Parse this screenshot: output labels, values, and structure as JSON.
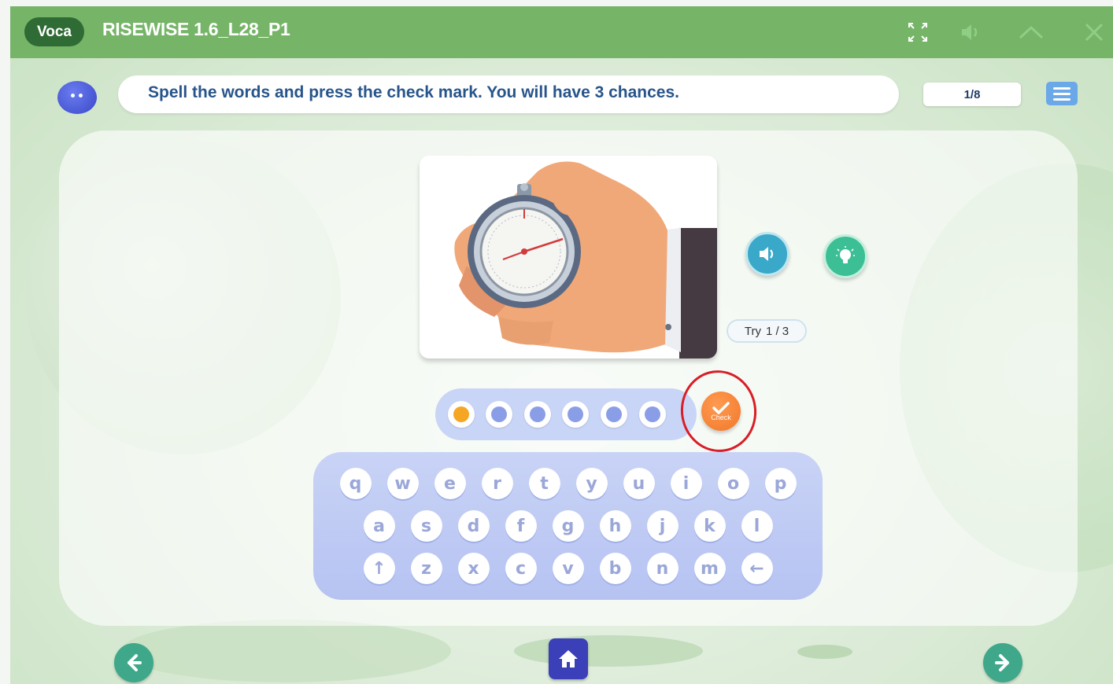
{
  "header": {
    "badge": "Voca",
    "title": "RISEWISE 1.6_L28_P1",
    "controls": [
      "fullscreen-icon",
      "speaker-icon",
      "chevron-up-icon",
      "close-icon"
    ]
  },
  "instruction": {
    "text": "Spell the words and press the check mark. You will have 3 chances.",
    "progress": "1/8"
  },
  "activity": {
    "image_subject": "stopwatch-in-hand",
    "try_label": "Try",
    "try_count": "1 / 3",
    "slots_total": 6,
    "active_slot": 1,
    "check_label": "Check"
  },
  "keyboard": {
    "row1": [
      "q",
      "w",
      "e",
      "r",
      "t",
      "y",
      "u",
      "i",
      "o",
      "p"
    ],
    "row2": [
      "a",
      "s",
      "d",
      "f",
      "g",
      "h",
      "j",
      "k",
      "l"
    ],
    "row3": [
      "↑",
      "z",
      "x",
      "c",
      "v",
      "b",
      "n",
      "m",
      "←"
    ]
  },
  "colors": {
    "header_green": "#76b468",
    "instruction_blue": "#27558b",
    "check_orange": "#f0782b",
    "highlight_red": "#d81e26",
    "nav_teal": "#3fa88b",
    "home_indigo": "#3b3fb8"
  }
}
